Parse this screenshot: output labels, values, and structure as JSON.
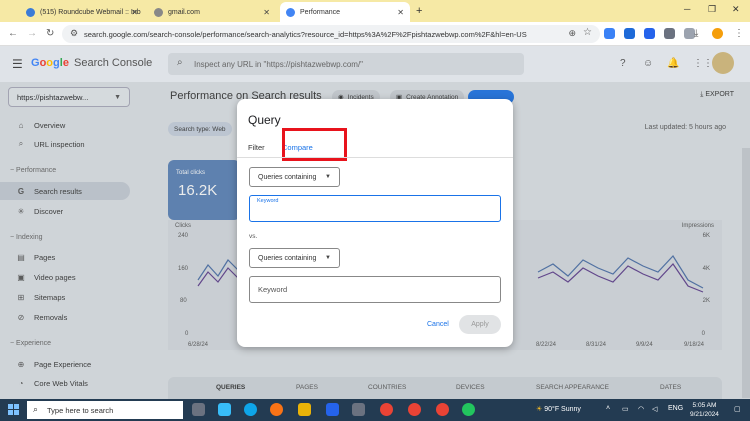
{
  "browser": {
    "tabs": [
      {
        "label": "(515) Roundcube Webmail :: Inb",
        "active": false
      },
      {
        "label": "gmail.com",
        "active": false
      },
      {
        "label": "Performance",
        "active": true
      }
    ],
    "url": "search.google.com/search-console/performance/search-analytics?resource_id=https%3A%2F%2Fpishtazwebwp.com%2F&hl=en-US"
  },
  "gsc": {
    "logo_google": "Google",
    "logo_product": "Search Console",
    "search_placeholder": "Inspect any URL in \"https://pishtazwebwp.com/\"",
    "property": "https://pishtazwebw..."
  },
  "sidebar": {
    "items": [
      {
        "label": "Overview",
        "icon": "home-icon"
      },
      {
        "label": "URL inspection",
        "icon": "search-icon"
      }
    ],
    "performance_heading": "Performance",
    "performance_items": [
      {
        "label": "Search results",
        "icon": "google-g-icon",
        "active": true
      },
      {
        "label": "Discover",
        "icon": "asterisk-icon"
      }
    ],
    "indexing_heading": "Indexing",
    "indexing_items": [
      {
        "label": "Pages",
        "icon": "page-icon"
      },
      {
        "label": "Video pages",
        "icon": "video-icon"
      },
      {
        "label": "Sitemaps",
        "icon": "sitemap-icon"
      },
      {
        "label": "Removals",
        "icon": "removals-icon"
      }
    ],
    "experience_heading": "Experience",
    "experience_items": [
      {
        "label": "Page Experience",
        "icon": "page-experience-icon"
      },
      {
        "label": "Core Web Vitals",
        "icon": "speed-icon"
      }
    ]
  },
  "main": {
    "page_title": "Performance on Search results",
    "chip_incidents": "Incidents",
    "chip_annotation": "Create Annotation",
    "export_label": "EXPORT",
    "search_type": "Search type: Web",
    "last_updated": "Last updated: 5 hours ago",
    "total_clicks_label": "Total clicks",
    "total_clicks_value": "16.2K",
    "chart_left_axis_title": "Clicks",
    "chart_right_axis_title": "Impressions",
    "chart_left_ticks": [
      "240",
      "160",
      "80",
      "0"
    ],
    "chart_right_ticks": [
      "6K",
      "4K",
      "2K",
      "0"
    ],
    "chart_x_ticks": [
      "6/28/24",
      "8/22/24",
      "8/31/24",
      "9/9/24",
      "9/18/24"
    ],
    "bottom_tabs": [
      "QUERIES",
      "PAGES",
      "COUNTRIES",
      "DEVICES",
      "SEARCH APPEARANCE",
      "DATES"
    ]
  },
  "modal": {
    "title": "Query",
    "tab_filter": "Filter",
    "tab_compare": "Compare",
    "select1": "Queries containing",
    "keyword1_label": "Keyword",
    "vs_label": "vs.",
    "select2": "Queries containing",
    "keyword2_placeholder": "Keyword",
    "cancel_label": "Cancel",
    "apply_label": "Apply"
  },
  "taskbar": {
    "search_placeholder": "Type here to search",
    "weather": "90°F  Sunny",
    "lang": "ENG",
    "time": "5:05 AM",
    "date": "9/21/2024"
  },
  "colors": {
    "accent": "#1a73e8",
    "highlight_box": "#e8131c",
    "clicks_card": "#5a82b8",
    "taskbar": "#233b52",
    "tabstrip": "#f6e9a5"
  }
}
